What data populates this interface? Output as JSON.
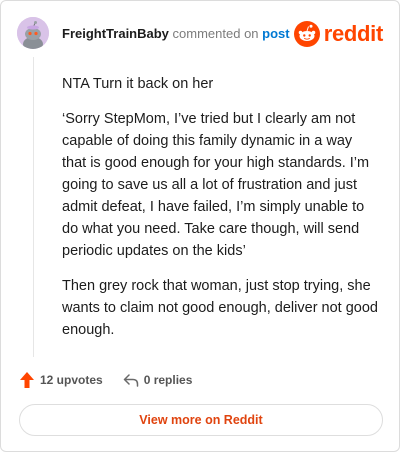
{
  "header": {
    "username": "FreightTrainBaby",
    "verb": "commented on",
    "post_link": "post",
    "brand": "reddit"
  },
  "comment": {
    "paragraphs": [
      "NTA Turn it back on her",
      "‘Sorry StepMom, I’ve tried but I clearly am not capable of doing this family dynamic in a way that is good enough for your high standards. I’m going to save us all a lot of frustration and just admit defeat, I have failed, I’m simply unable to do what you need. Take care though, will send periodic updates on the kids’",
      "Then grey rock that woman, just stop trying, she wants to claim not good enough, deliver not good enough."
    ]
  },
  "actions": {
    "upvotes": "12 upvotes",
    "replies": "0 replies"
  },
  "footer": {
    "view_more": "View more on Reddit"
  },
  "colors": {
    "accent": "#ff4500",
    "link": "#0079d3"
  },
  "icons": [
    "avatar-icon",
    "reddit-logo-icon",
    "upvote-arrow-icon",
    "reply-icon"
  ]
}
